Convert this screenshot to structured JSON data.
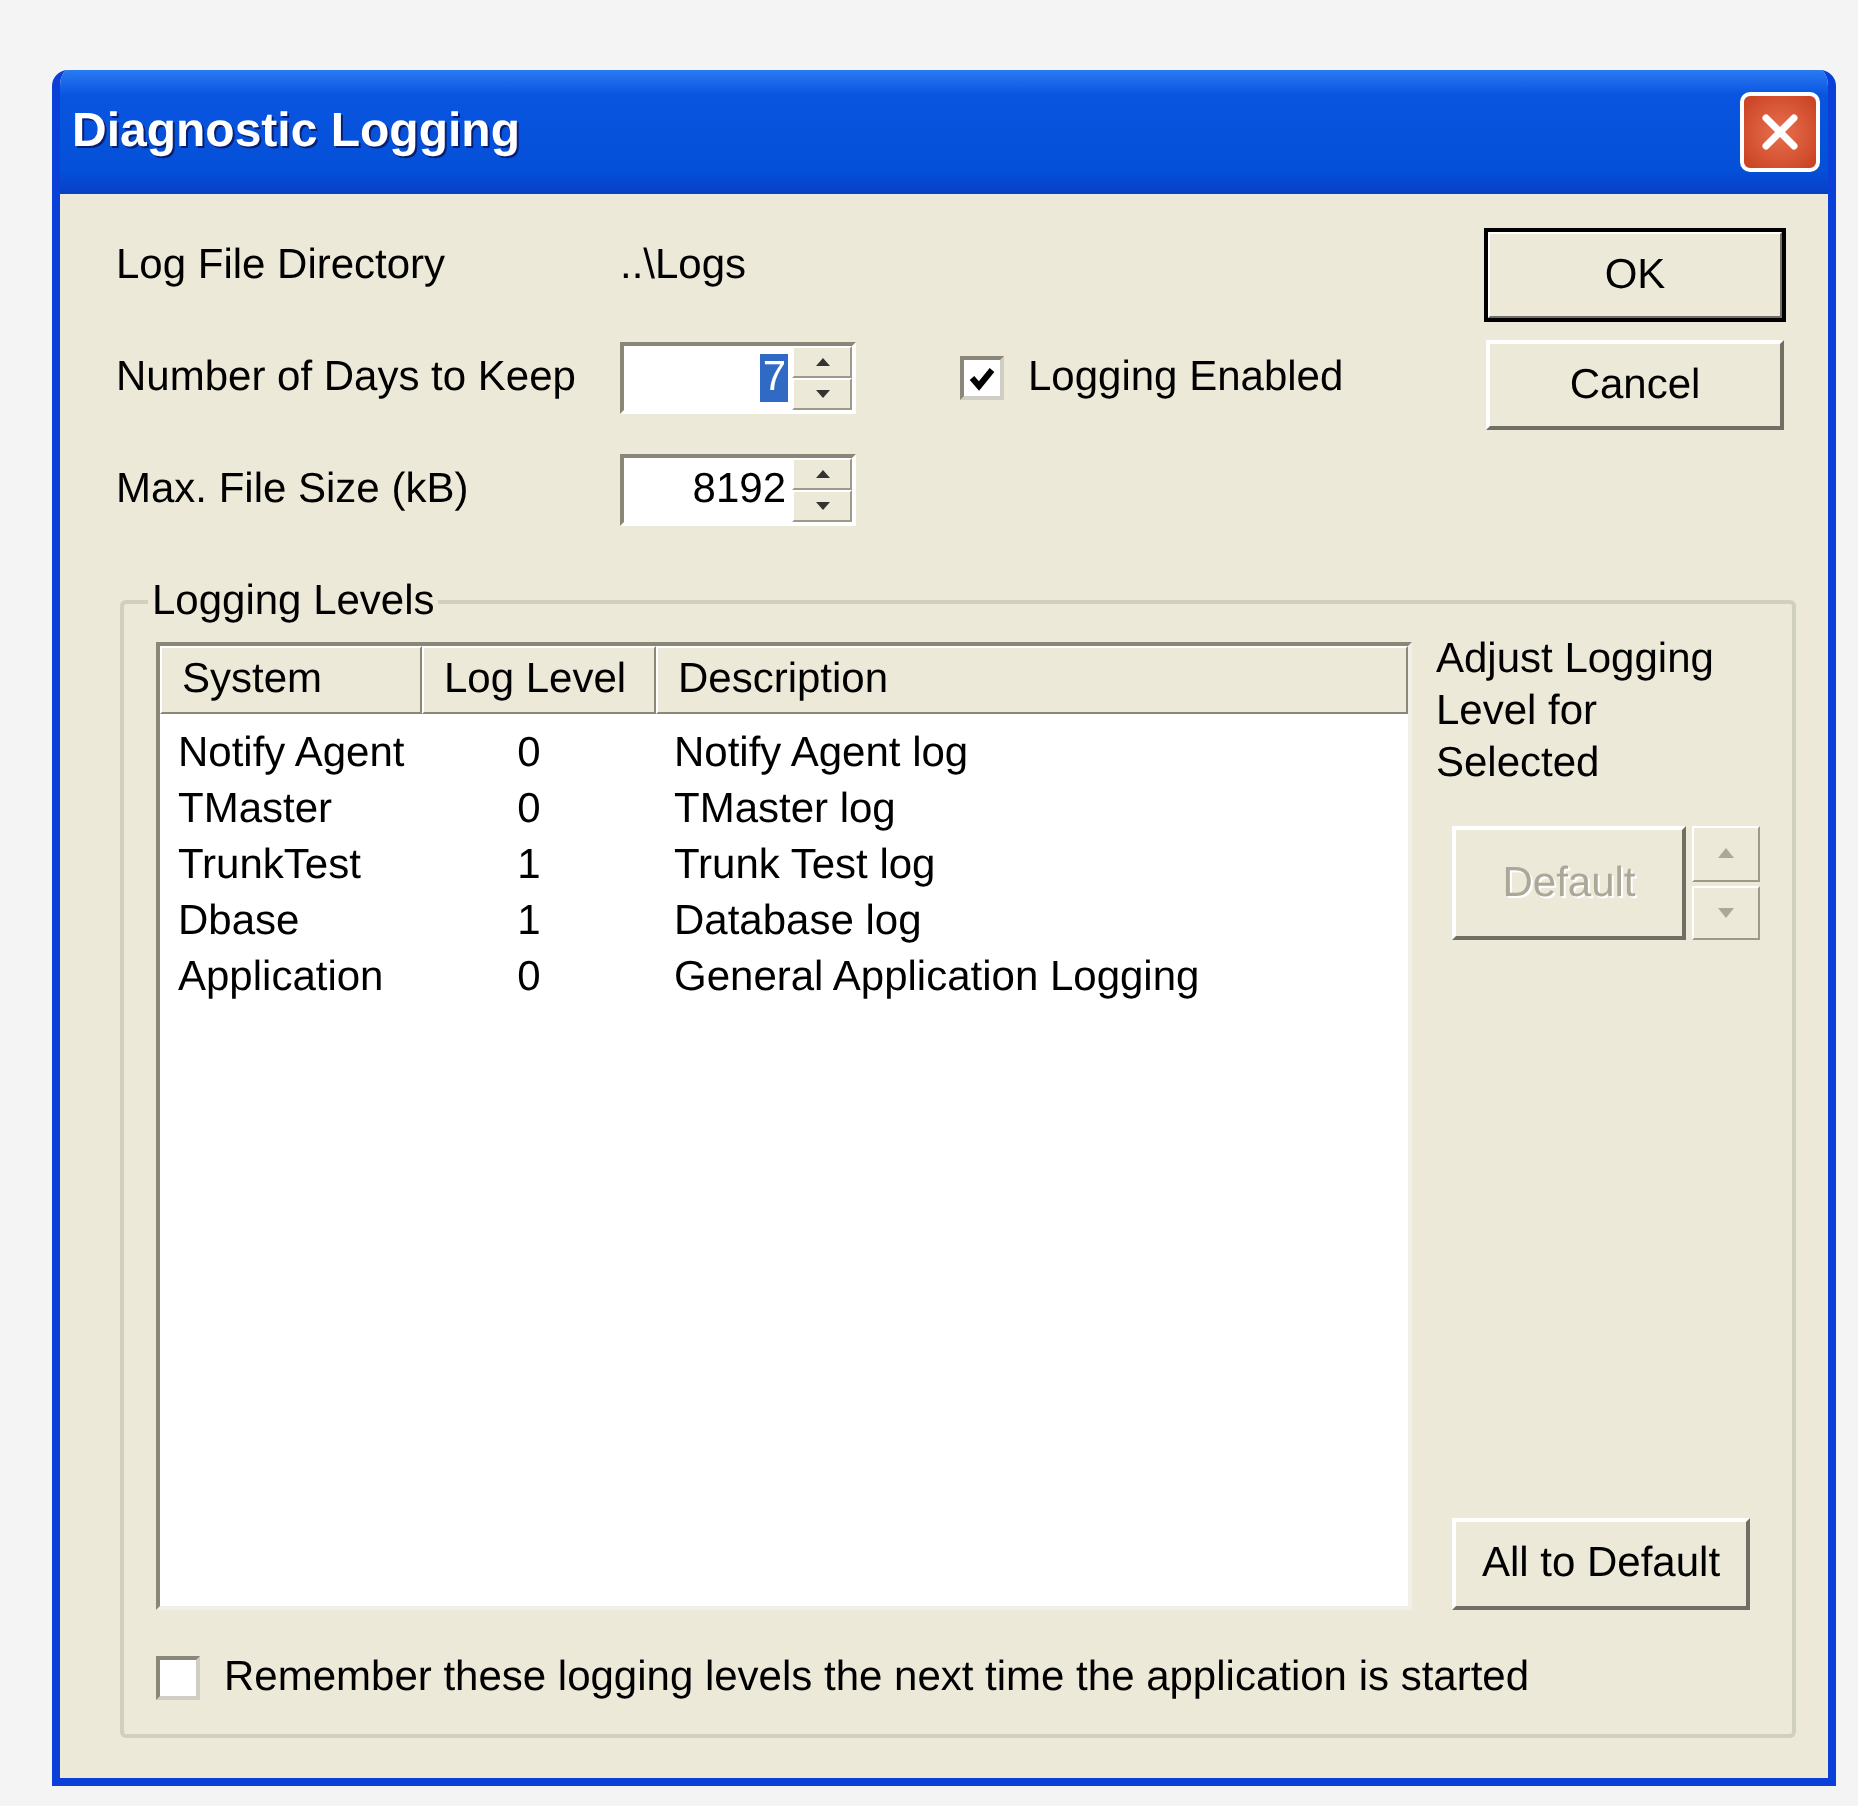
{
  "window": {
    "title": "Diagnostic Logging"
  },
  "log_directory": {
    "label": "Log File Directory",
    "value": "..\\Logs"
  },
  "fields": [
    {
      "label": "Number of Days to Keep",
      "value": "7",
      "text_selected": true
    },
    {
      "label": "Max. File Size (kB)",
      "value": "8192",
      "text_selected": false
    }
  ],
  "logging_enabled": {
    "label": "Logging Enabled",
    "checked": true
  },
  "buttons": [
    {
      "label": "OK",
      "default": true
    },
    {
      "label": "Cancel",
      "default": false
    }
  ],
  "logging_levels": {
    "title": "Logging Levels",
    "columns": [
      "System",
      "Log Level",
      "Description"
    ],
    "rows": [
      {
        "system": "Notify Agent",
        "level": "0",
        "description": "Notify Agent log"
      },
      {
        "system": "TMaster",
        "level": "0",
        "description": "TMaster log"
      },
      {
        "system": "TrunkTest",
        "level": "1",
        "description": "Trunk Test log"
      },
      {
        "system": "Dbase",
        "level": "1",
        "description": "Database log"
      },
      {
        "system": "Application",
        "level": "0",
        "description": "General Application Logging"
      }
    ],
    "adjust_label": "Adjust Logging Level for Selected",
    "level_button": {
      "label": "Default",
      "disabled": true
    },
    "all_default_button": {
      "label": "All to Default"
    },
    "remember": {
      "label": "Remember these logging levels the next time the application is started",
      "checked": false
    }
  }
}
